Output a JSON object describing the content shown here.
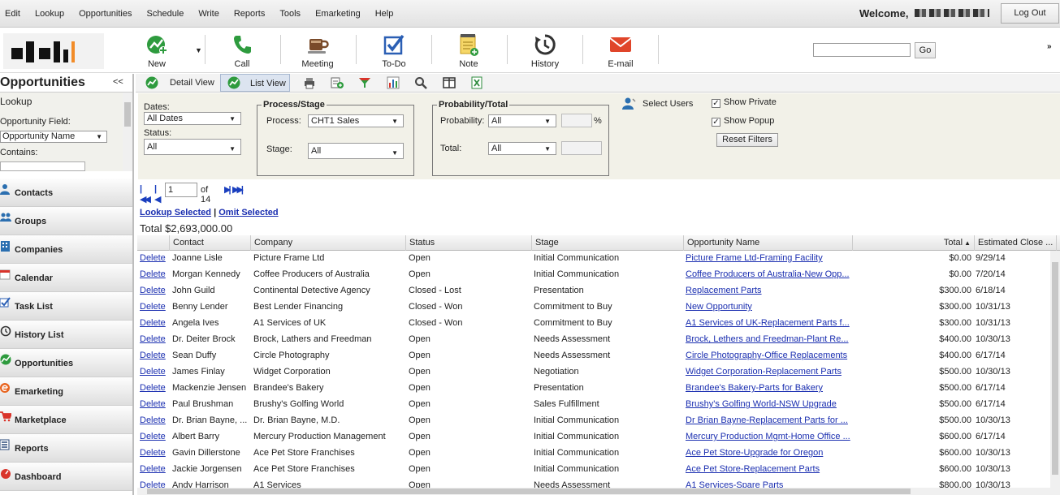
{
  "menu": [
    "Edit",
    "Lookup",
    "Opportunities",
    "Schedule",
    "Write",
    "Reports",
    "Tools",
    "Emarketing",
    "Help"
  ],
  "header": {
    "welcome": "Welcome,",
    "logout": "Log Out"
  },
  "toolbar": {
    "new": "New",
    "call": "Call",
    "meeting": "Meeting",
    "todo": "To-Do",
    "note": "Note",
    "history": "History",
    "email": "E-mail",
    "go": "Go"
  },
  "sidebar": {
    "title": "Opportunities",
    "collapse": "<<",
    "lookup": {
      "heading": "Lookup",
      "field_label": "Opportunity Field:",
      "field_value": "Opportunity Name",
      "contains_label": "Contains:"
    },
    "nav": [
      "Contacts",
      "Groups",
      "Companies",
      "Calendar",
      "Task List",
      "History List",
      "Opportunities",
      "Emarketing",
      "Marketplace",
      "Reports",
      "Dashboard"
    ]
  },
  "views": {
    "detail": "Detail View",
    "list": "List View"
  },
  "filters": {
    "dates_label": "Dates:",
    "dates_value": "All Dates",
    "status_label": "Status:",
    "status_value": "All",
    "process_group": "Process/Stage",
    "process_label": "Process:",
    "process_value": "CHT1 Sales",
    "stage_label": "Stage:",
    "stage_value": "All",
    "prob_group": "Probability/Total",
    "probability_label": "Probability:",
    "probability_value": "All",
    "percent": "%",
    "total_label": "Total:",
    "total_value": "All",
    "select_users": "Select Users",
    "show_private": "Show Private",
    "show_popup": "Show Popup",
    "reset": "Reset Filters"
  },
  "pager": {
    "page": "1",
    "of": "of 14"
  },
  "links": {
    "lookup_selected": "Lookup Selected",
    "sep": "|",
    "omit_selected": "Omit Selected"
  },
  "total": "Total $2,693,000.00",
  "table": {
    "headers": [
      "Contact",
      "Company",
      "Status",
      "Stage",
      "Opportunity Name",
      "Total",
      "Estimated Close ..."
    ],
    "rows": [
      {
        "del": "Delete",
        "contact": "Joanne Lisle",
        "company": "Picture Frame Ltd",
        "status": "Open",
        "stage": "Initial Communication",
        "opp": "Picture Frame Ltd-Framing Facility",
        "total": "$0.00",
        "close": "9/29/14"
      },
      {
        "del": "Delete",
        "contact": "Morgan Kennedy",
        "company": "Coffee Producers of Australia",
        "status": "Open",
        "stage": "Initial Communication",
        "opp": "Coffee Producers of Australia-New Opp...",
        "total": "$0.00",
        "close": "7/20/14"
      },
      {
        "del": "Delete",
        "contact": "John Guild",
        "company": "Continental Detective Agency",
        "status": "Closed - Lost",
        "stage": "Presentation",
        "opp": "Replacement Parts",
        "total": "$300.00",
        "close": "6/18/14"
      },
      {
        "del": "Delete",
        "contact": "Benny Lender",
        "company": "Best Lender Financing",
        "status": "Closed - Won",
        "stage": "Commitment to Buy",
        "opp": "New Opportunity",
        "total": "$300.00",
        "close": "10/31/13"
      },
      {
        "del": "Delete",
        "contact": "Angela Ives",
        "company": "A1 Services of UK",
        "status": "Closed - Won",
        "stage": "Commitment to Buy",
        "opp": "A1 Services of UK-Replacement Parts f...",
        "total": "$300.00",
        "close": "10/31/13"
      },
      {
        "del": "Delete",
        "contact": "Dr. Deiter Brock",
        "company": "Brock, Lathers and Freedman",
        "status": "Open",
        "stage": "Needs Assessment",
        "opp": "Brock, Lethers and Freedman-Plant Re...",
        "total": "$400.00",
        "close": "10/30/13"
      },
      {
        "del": "Delete",
        "contact": "Sean Duffy",
        "company": "Circle Photography",
        "status": "Open",
        "stage": "Needs Assessment",
        "opp": "Circle Photography-Office Replacements",
        "total": "$400.00",
        "close": "6/17/14"
      },
      {
        "del": "Delete",
        "contact": "James Finlay",
        "company": "Widget Corporation",
        "status": "Open",
        "stage": "Negotiation",
        "opp": "Widget Corporation-Replacement Parts",
        "total": "$500.00",
        "close": "10/30/13"
      },
      {
        "del": "Delete",
        "contact": "Mackenzie Jensen",
        "company": "Brandee's Bakery",
        "status": "Open",
        "stage": "Presentation",
        "opp": "Brandee's Bakery-Parts for Bakery",
        "total": "$500.00",
        "close": "6/17/14"
      },
      {
        "del": "Delete",
        "contact": "Paul Brushman",
        "company": "Brushy's Golfing World",
        "status": "Open",
        "stage": "Sales Fulfillment",
        "opp": "Brushy's Golfing World-NSW Upgrade",
        "total": "$500.00",
        "close": "6/17/14"
      },
      {
        "del": "Delete",
        "contact": "Dr. Brian Bayne, ...",
        "company": "Dr. Brian Bayne, M.D.",
        "status": "Open",
        "stage": "Initial Communication",
        "opp": "Dr Brian Bayne-Replacement Parts for ...",
        "total": "$500.00",
        "close": "10/30/13"
      },
      {
        "del": "Delete",
        "contact": "Albert Barry",
        "company": "Mercury Production Management",
        "status": "Open",
        "stage": "Initial Communication",
        "opp": "Mercury Production Mgmt-Home Office ...",
        "total": "$600.00",
        "close": "6/17/14"
      },
      {
        "del": "Delete",
        "contact": "Gavin Dillerstone",
        "company": "Ace Pet Store Franchises",
        "status": "Open",
        "stage": "Initial Communication",
        "opp": "Ace Pet Store-Upgrade for Oregon",
        "total": "$600.00",
        "close": "10/30/13"
      },
      {
        "del": "Delete",
        "contact": "Jackie Jorgensen",
        "company": "Ace Pet Store Franchises",
        "status": "Open",
        "stage": "Initial Communication",
        "opp": "Ace Pet Store-Replacement Parts",
        "total": "$600.00",
        "close": "10/30/13"
      },
      {
        "del": "Delete",
        "contact": "Andy Harrison",
        "company": "A1 Services",
        "status": "Open",
        "stage": "Needs Assessment",
        "opp": "A1 Services-Spare Parts",
        "total": "$800.00",
        "close": "10/30/13"
      }
    ]
  },
  "colors": {
    "link": "#1a2eb0",
    "filter_bg": "#f2f1e8",
    "green_icon": "#2e9b3e",
    "email_icon": "#e0452a"
  }
}
